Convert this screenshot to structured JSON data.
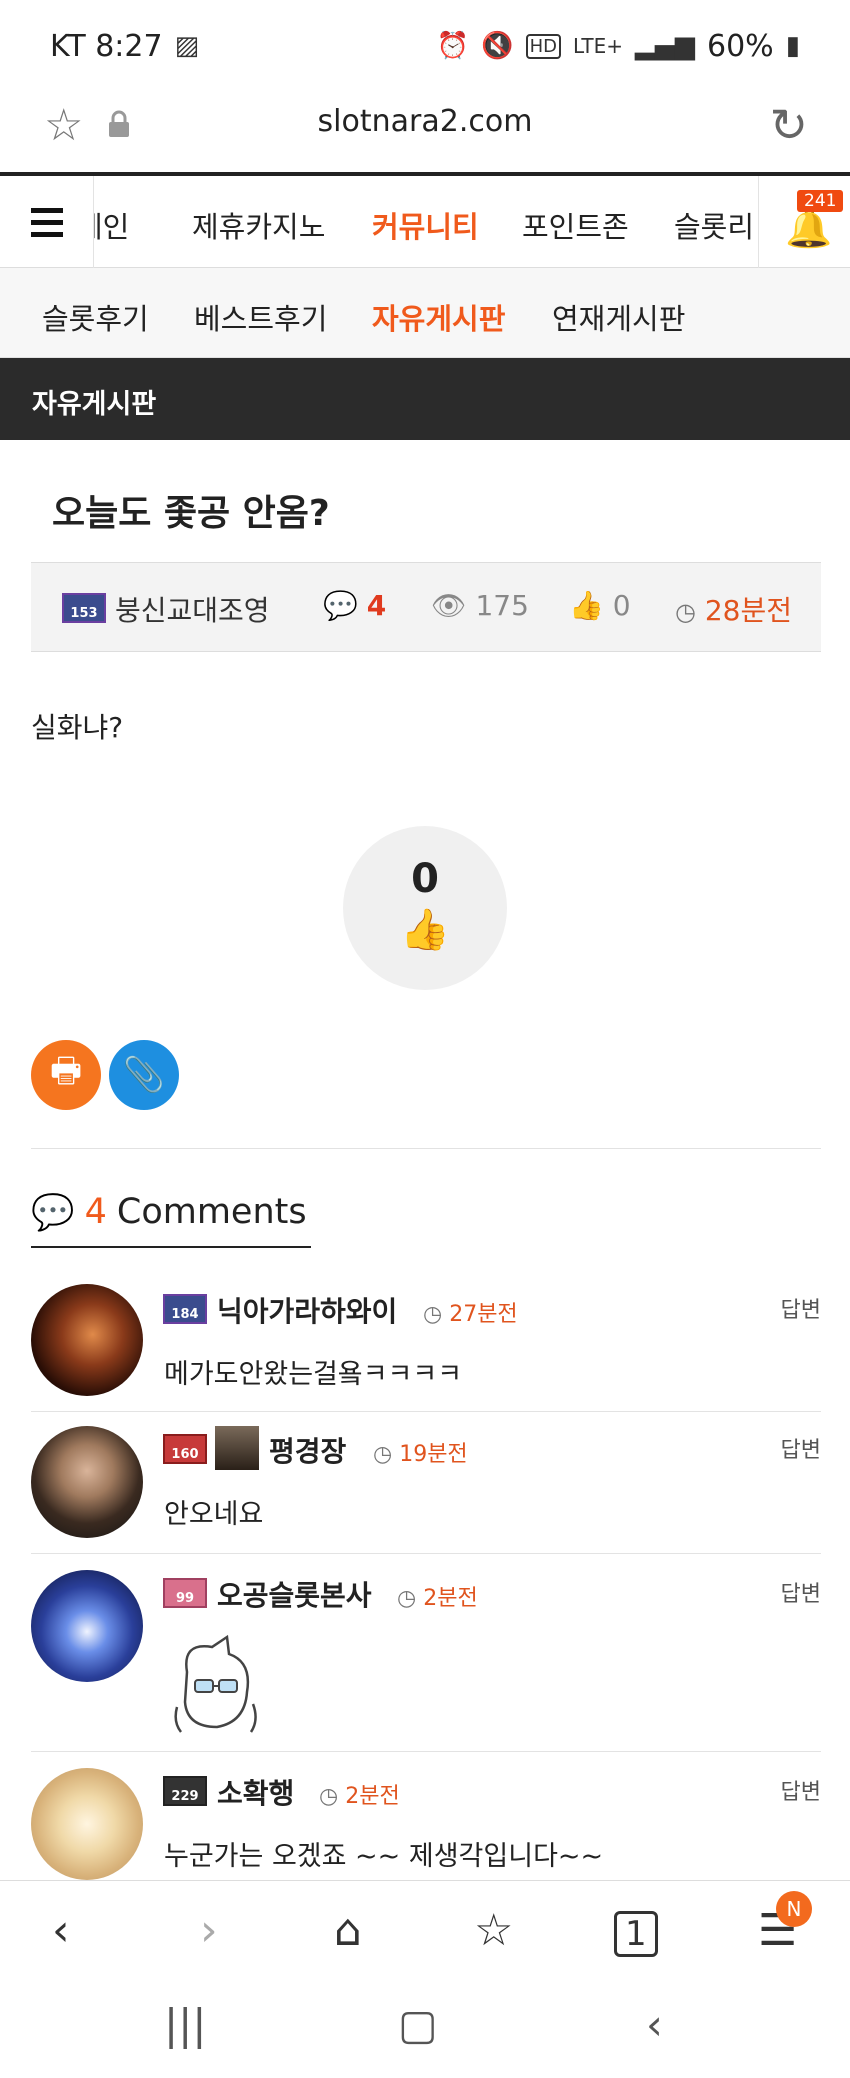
{
  "statusbar": {
    "carrier_time": "KT 8:27",
    "battery": "60%",
    "network": "LTE+"
  },
  "browser": {
    "url": "slotnara2.com"
  },
  "sitenav": {
    "items": [
      "메인",
      "제휴카지노",
      "커뮤니티",
      "포인트존",
      "슬롯리"
    ],
    "active": "커뮤니티",
    "notification_count": "241"
  },
  "subnav": {
    "items": [
      "슬롯후기",
      "베스트후기",
      "자유게시판",
      "연재게시판"
    ],
    "active": "자유게시판"
  },
  "board": {
    "name": "자유게시판"
  },
  "post": {
    "title": "오늘도 좇공 안옴?",
    "author_level": "153",
    "author": "붕신교대조영",
    "comment_count": "4",
    "views": "175",
    "likes": "0",
    "time": "28분전",
    "body": "실화냐?",
    "like_total": "0"
  },
  "comments_section": {
    "count": "4",
    "label": "Comments"
  },
  "comments": [
    {
      "level": "184",
      "name": "닉아가라하와이",
      "time": "27분전",
      "reply": "답변",
      "text": "메가도안왔는걸욬ㅋㅋㅋㅋ"
    },
    {
      "level": "160",
      "name": "평경장",
      "time": "19분전",
      "reply": "답변",
      "text": "안오네요"
    },
    {
      "level": "99",
      "name": "오공슬롯본사",
      "time": "2분전",
      "reply": "답변",
      "text": ""
    },
    {
      "level": "229",
      "name": "소확행",
      "time": "2분전",
      "reply": "답변",
      "text": "누군가는 오겠죠 ~~  제생각입니다~~"
    }
  ],
  "bottombar": {
    "tab_count": "1",
    "menu_badge": "N"
  },
  "colors": {
    "accent": "#f05a1c",
    "header_dark": "#2b2b2b",
    "print_button": "#f5751f",
    "link_button": "#1e8fe0"
  }
}
